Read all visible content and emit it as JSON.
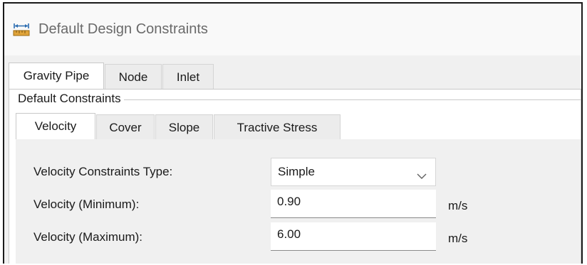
{
  "window": {
    "title": "Default Design Constraints",
    "icon": "ruler-icon"
  },
  "element_tabs": [
    {
      "label": "Gravity Pipe",
      "active": true
    },
    {
      "label": "Node",
      "active": false
    },
    {
      "label": "Inlet",
      "active": false
    }
  ],
  "group": {
    "label": "Default Constraints"
  },
  "constraint_tabs": [
    {
      "label": "Velocity",
      "active": true
    },
    {
      "label": "Cover",
      "active": false
    },
    {
      "label": "Slope",
      "active": false
    },
    {
      "label": "Tractive Stress",
      "active": false
    }
  ],
  "velocity": {
    "type_label": "Velocity Constraints Type:",
    "type_value": "Simple",
    "min_label": "Velocity (Minimum):",
    "min_value": "0.90",
    "min_unit": "m/s",
    "max_label": "Velocity (Maximum):",
    "max_value": "6.00",
    "max_unit": "m/s"
  }
}
